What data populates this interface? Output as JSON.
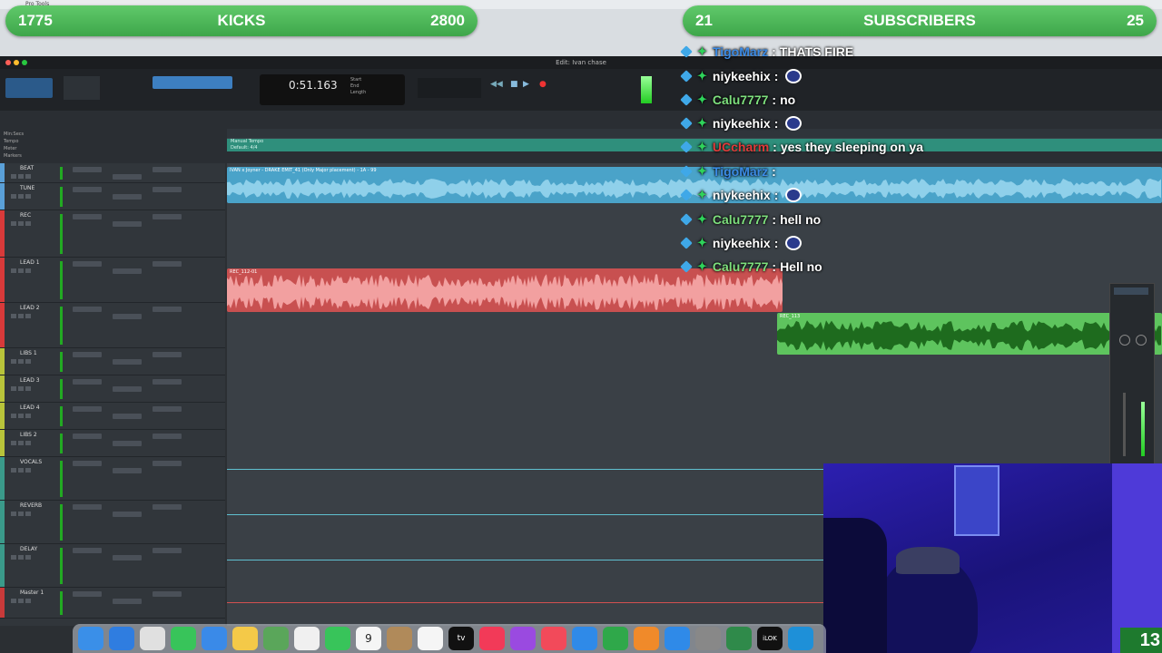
{
  "overlay": {
    "left_banner": {
      "left_value": "1775",
      "label": "KICKS",
      "right_value": "2800"
    },
    "right_banner": {
      "left_value": "21",
      "label": "SUBSCRIBERS",
      "right_value": "25"
    },
    "corner_count": "13"
  },
  "app": {
    "window_title": "Edit: Ivan chase",
    "counter_main": "0:51.163",
    "counter_labels": [
      "Start",
      "End",
      "Length"
    ],
    "menu_label": "Pro Tools"
  },
  "ruler": {
    "labels": [
      "Min:Secs",
      "Tempo",
      "Meter",
      "Markers"
    ],
    "tempo_label": "Manual Tempo",
    "meter_label": "Default: 4/4"
  },
  "tracks": [
    {
      "name": "BEAT",
      "color": "#5aa0d8"
    },
    {
      "name": "TUNE",
      "color": "#5aa0d8"
    },
    {
      "name": "REC",
      "color": "#d83a3a"
    },
    {
      "name": "LEAD 1",
      "color": "#d83a3a"
    },
    {
      "name": "LEAD 2",
      "color": "#d83a3a"
    },
    {
      "name": "LIBS 1",
      "color": "#b8c43a"
    },
    {
      "name": "LEAD 3",
      "color": "#b8c43a"
    },
    {
      "name": "LEAD 4",
      "color": "#b8c43a"
    },
    {
      "name": "LIBS 2",
      "color": "#b8c43a"
    },
    {
      "name": "VOCALS",
      "color": "#3a9a8a"
    },
    {
      "name": "REVERB",
      "color": "#3a9a8a"
    },
    {
      "name": "DELAY",
      "color": "#3a9a8a"
    },
    {
      "name": "Master 1",
      "color": "#c83a3a"
    }
  ],
  "clips": {
    "beat_clip": "IVAN x Joyner - DRAKE EMIT_41 (Only Major placement) - 1A - 99",
    "rec_clip": "REC_112-01",
    "lead_clip": "REC_113"
  },
  "chat": [
    {
      "name": "TigoMarz",
      "message": "THATS FIRE",
      "name_color": "#3b8be6",
      "emote": false
    },
    {
      "name": "niykeehix",
      "message": "",
      "name_color": "#ffffff",
      "emote": true
    },
    {
      "name": "Calu7777",
      "message": "no",
      "name_color": "#7ee07e",
      "emote": false
    },
    {
      "name": "niykeehix",
      "message": "",
      "name_color": "#ffffff",
      "emote": true
    },
    {
      "name": "UCcharm",
      "message": "yes they sleeping on ya",
      "name_color": "#e23a3a",
      "emote": false
    },
    {
      "name": "TigoMarz",
      "message": "",
      "name_color": "#3b8be6",
      "emote": false
    },
    {
      "name": "niykeehix",
      "message": "",
      "name_color": "#ffffff",
      "emote": true
    },
    {
      "name": "Calu7777",
      "message": "hell no",
      "name_color": "#7ee07e",
      "emote": false
    },
    {
      "name": "niykeehix",
      "message": "",
      "name_color": "#ffffff",
      "emote": true
    },
    {
      "name": "Calu7777",
      "message": "Hell no",
      "name_color": "#7ee07e",
      "emote": false
    }
  ],
  "dock": {
    "icons": [
      "finder-icon",
      "safari-icon",
      "launchpad-icon",
      "messages-icon",
      "mail-icon",
      "notes-icon",
      "maps-icon",
      "photos-icon",
      "facetime-icon",
      "calendar-icon",
      "contacts-icon",
      "reminders-icon",
      "tv-icon",
      "music-icon",
      "podcasts-icon",
      "news-icon",
      "keynote-icon",
      "numbers-icon",
      "pages-icon",
      "appstore-icon",
      "settings-icon",
      "protools-icon",
      "ilok-icon",
      "obs-icon"
    ],
    "calendar_day": "9",
    "tv_label": "tv",
    "ilok_label": "iLOK"
  },
  "colors": {
    "banner_green": "#4cb858",
    "beat_clip": "#4aa3c9",
    "rec_clip": "#c85050",
    "lead_clip": "#5ec45e"
  }
}
